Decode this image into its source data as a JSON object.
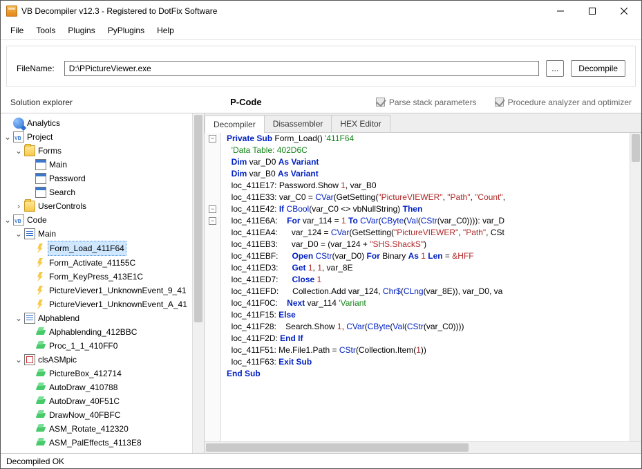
{
  "window": {
    "title": "VB Decompiler v12.3 - Registered to DotFix Software"
  },
  "menu": [
    "File",
    "Tools",
    "Plugins",
    "PyPlugins",
    "Help"
  ],
  "file": {
    "label": "FileName:",
    "path": "D:\\PPictureViewer.exe",
    "browse": "...",
    "decompile": "Decompile"
  },
  "subbar": {
    "left": "Solution explorer",
    "mid": "P-Code",
    "chk1": "Parse stack parameters",
    "chk2": "Procedure analyzer and optimizer"
  },
  "tabs": [
    "Decompiler",
    "Disassembler",
    "HEX Editor"
  ],
  "tree": {
    "analytics": "Analytics",
    "project": "Project",
    "forms": "Forms",
    "form_items": [
      "Main",
      "Password",
      "Search"
    ],
    "usercontrols": "UserControls",
    "code": "Code",
    "main": "Main",
    "main_subs": [
      "Form_Load_411F64",
      "Form_Activate_41155C",
      "Form_KeyPress_413E1C",
      "PictureViever1_UnknownEvent_9_41",
      "PictureViever1_UnknownEvent_A_41"
    ],
    "alpha": "Alphablend",
    "alpha_subs": [
      "Alphablending_412BBC",
      "Proc_1_1_410FF0"
    ],
    "cls": "clsASMpic",
    "cls_subs": [
      "PictureBox_412714",
      "AutoDraw_410788",
      "AutoDraw_40F51C",
      "DrawNow_40FBFC",
      "ASM_Rotate_412320",
      "ASM_PalEffects_4113E8"
    ]
  },
  "code": {
    "l0a": "Private",
    "l0b": "Sub",
    "l0c": " Form_Load() ",
    "l0d": "'411F64",
    "l1": "'Data Table: 402D6C",
    "l2a": "Dim",
    "l2b": " var_D0 ",
    "l2c": "As",
    "l2d": " Variant",
    "l3a": "Dim",
    "l3b": " var_B0 ",
    "l3c": "As",
    "l3d": " Variant",
    "l4a": "loc_411E17: Password.Show ",
    "l4b": "1",
    "l4c": ", var_B0",
    "l5a": "loc_411E33: var_C0 = ",
    "l5b": "CVar",
    "l5c": "(GetSetting(",
    "l5d": "\"PictureVIEWER\"",
    "l5e": ", ",
    "l5f": "\"Path\"",
    "l5g": ", ",
    "l5h": "\"Count\"",
    "l5i": ",",
    "l6a": "loc_411E42: ",
    "l6b": "If",
    "l6c": " CBool",
    "l6d": "(var_C0 <> vbNullString) ",
    "l6e": "Then",
    "l7a": "loc_411E6A:    ",
    "l7b": "For",
    "l7c": " var_114 = ",
    "l7d": "1",
    "l7e": " To",
    "l7f": " CVar",
    "l7g": "(",
    "l7h": "CByte",
    "l7i": "(",
    "l7j": "Val",
    "l7k": "(",
    "l7l": "CStr",
    "l7m": "(var_C0)))): var_D",
    "l8a": "loc_411EA4:      var_124 = ",
    "l8b": "CVar",
    "l8c": "(GetSetting(",
    "l8d": "\"PictureVIEWER\"",
    "l8e": ", ",
    "l8f": "\"Path\"",
    "l8g": ", CSt",
    "l9a": "loc_411EB3:      var_D0 = (var_124 + ",
    "l9b": "\"SHS.ShackS\"",
    "l9c": ")",
    "l10a": "loc_411EBF:      ",
    "l10b": "Open",
    "l10c": " CStr",
    "l10d": "(var_D0) ",
    "l10e": "For",
    "l10f": " Binary ",
    "l10g": "As",
    "l10h": " 1",
    "l10i": " Len",
    "l10j": " = ",
    "l10k": "&HFF",
    "l11a": "loc_411ED3:      ",
    "l11b": "Get",
    "l11c": " 1",
    "l11d": ", ",
    "l11e": "1",
    "l11f": ", var_8E",
    "l12a": "loc_411ED7:      ",
    "l12b": "Close",
    "l12c": " 1",
    "l13a": "loc_411EFD:      Collection.Add var_124, ",
    "l13b": "Chr$",
    "l13c": "(",
    "l13d": "CLng",
    "l13e": "(var_8E)), var_D0, va",
    "l14a": "loc_411F0C:    ",
    "l14b": "Next",
    "l14c": " var_114 ",
    "l14d": "'Variant",
    "l15a": "loc_411F15: ",
    "l15b": "Else",
    "l16a": "loc_411F28:    Search.Show ",
    "l16b": "1",
    "l16c": ", ",
    "l16d": "CVar",
    "l16e": "(",
    "l16f": "CByte",
    "l16g": "(",
    "l16h": "Val",
    "l16i": "(",
    "l16j": "CStr",
    "l16k": "(var_C0))))",
    "l17a": "loc_411F2D: ",
    "l17b": "End If",
    "l18a": "loc_411F51: Me.File1.Path = ",
    "l18b": "CStr",
    "l18c": "(Collection.Item(",
    "l18d": "1",
    "l18e": "))",
    "l19a": "loc_411F63: ",
    "l19b": "Exit Sub",
    "l20": "End Sub"
  },
  "status": "Decompiled OK"
}
